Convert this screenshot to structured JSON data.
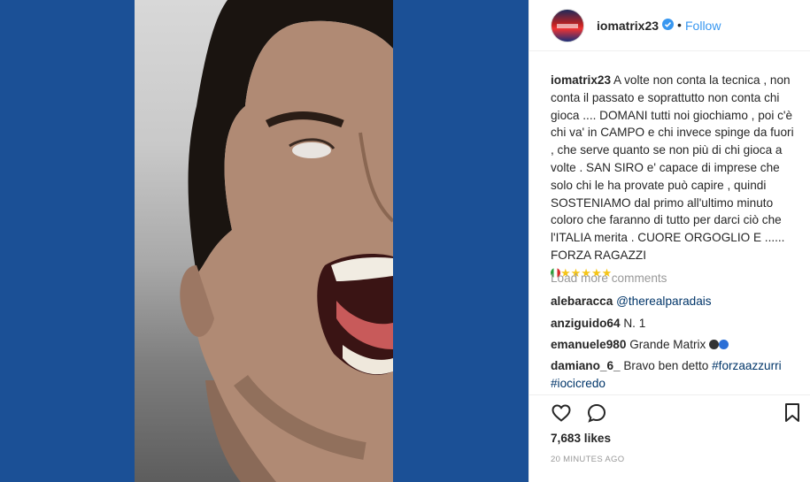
{
  "post": {
    "username": "iomatrix23",
    "follow_label": "Follow",
    "dot": "•",
    "caption_text": "A volte non conta la tecnica , non conta il passato e soprattutto non conta chi gioca .... DOMANI tutti noi giochiamo , poi c'è chi va' in CAMPO e chi invece spinge da fuori , che serve quanto se non più di chi gioca a volte . SAN SIRO e' capace di imprese che solo chi le ha provate può capire , quindi SOSTENIAMO dal primo all'ultimo minuto coloro che faranno di tutto per darci ciò che l'ITALIA merita . CUORE ORGOGLIO E ...... FORZA RAGAZZI",
    "caption_emoji": "★★★★★",
    "load_more": "Load more comments",
    "comments": [
      {
        "user": "alebaracca",
        "text": "",
        "mention": "@therealparadais"
      },
      {
        "user": "anziguido64",
        "text": "N. 1",
        "mention": ""
      },
      {
        "user": "emanuele980",
        "text": "Grande Matrix",
        "mention": ""
      },
      {
        "user": "damiano_6_",
        "text": "Bravo ben detto",
        "mention": "#forzaazzurri #iocicredo"
      }
    ],
    "likes": "7,683 likes",
    "time": "20 MINUTES AGO"
  },
  "colors": {
    "background_blue": "#1b5096",
    "link_blue": "#3897f0",
    "tag_blue": "#003569"
  },
  "icons": [
    "verified-badge-icon",
    "heart-icon",
    "comment-icon",
    "bookmark-icon",
    "italy-flag-emoji",
    "star-emoji",
    "black-circle-emoji",
    "blue-circle-emoji"
  ]
}
